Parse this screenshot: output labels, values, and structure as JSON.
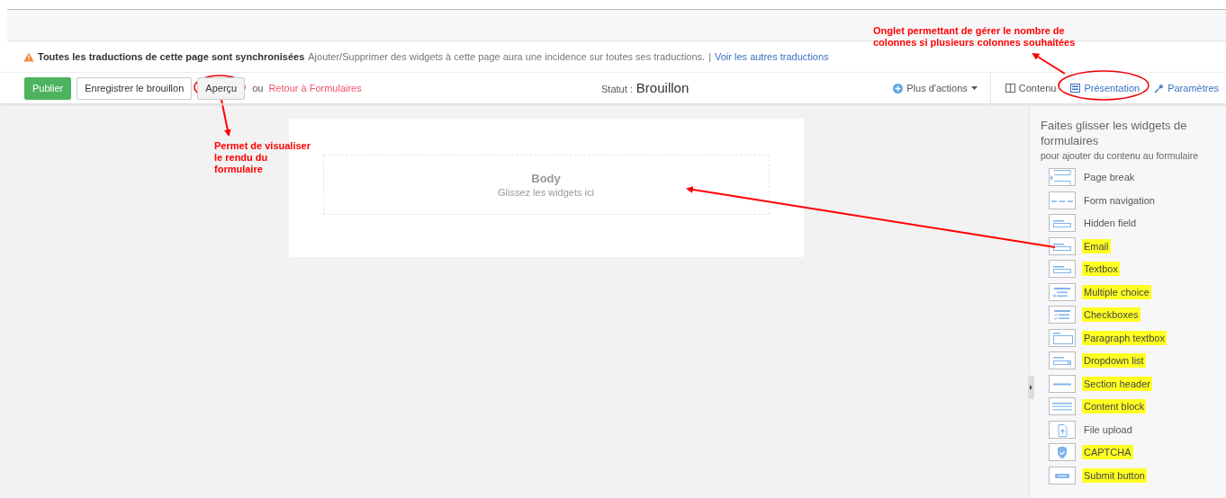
{
  "notice": {
    "title": "Toutes les traductions de cette page sont synchronisées",
    "text": "Ajouter/Supprimer des widgets à cette page aura une incidence sur toutes ses traductions.",
    "separator": "|",
    "link": "Voir les autres traductions"
  },
  "toolbar": {
    "buttons": [
      {
        "label": "Publier",
        "kind": "primary"
      },
      {
        "label": "Enregistrer le brouillon",
        "kind": "default"
      },
      {
        "label": "Aperçu",
        "kind": "default"
      }
    ],
    "or_text": "ou",
    "back_link": "Retour à Formulaires",
    "status_label": "Statut :",
    "status_value": "Brouillon",
    "actions": "Plus d'actions",
    "tabs": [
      {
        "label": "Contenu",
        "selected": true,
        "kind": "columns"
      },
      {
        "label": "Présentation",
        "selected": false,
        "kind": "layout"
      },
      {
        "label": "Paramètres",
        "selected": false,
        "kind": "wrench"
      }
    ]
  },
  "canvas": {
    "zone_title": "Body",
    "zone_hint": "Glissez les widgets ici"
  },
  "panel": {
    "title": "Faites glisser les widgets de formulaires",
    "subtitle": "pour ajouter du contenu au formulaire",
    "widgets": [
      {
        "label": "Page break",
        "kind": "pagebreak",
        "highlighted": false
      },
      {
        "label": "Form navigation",
        "kind": "navigation",
        "highlighted": false
      },
      {
        "label": "Hidden field",
        "kind": "field",
        "highlighted": false
      },
      {
        "label": "Email",
        "kind": "field",
        "highlighted": true
      },
      {
        "label": "Textbox",
        "kind": "field",
        "highlighted": true
      },
      {
        "label": "Multiple choice",
        "kind": "choice",
        "highlighted": true
      },
      {
        "label": "Checkboxes",
        "kind": "checklist",
        "highlighted": true
      },
      {
        "label": "Paragraph textbox",
        "kind": "paragraph",
        "highlighted": true
      },
      {
        "label": "Dropdown list",
        "kind": "dropdown",
        "highlighted": true
      },
      {
        "label": "Section header",
        "kind": "section",
        "highlighted": true
      },
      {
        "label": "Content block",
        "kind": "content",
        "highlighted": true
      },
      {
        "label": "File upload",
        "kind": "upload",
        "highlighted": false
      },
      {
        "label": "CAPTCHA",
        "kind": "captcha",
        "highlighted": true
      },
      {
        "label": "Submit button",
        "kind": "submit",
        "highlighted": true
      }
    ]
  },
  "annotations": [
    {
      "text": "Onglet permettant de gérer le nombre de colonnes si plusieurs colonnes souhaitées"
    },
    {
      "text": "Permet de visualiser le rendu du formulaire"
    }
  ]
}
